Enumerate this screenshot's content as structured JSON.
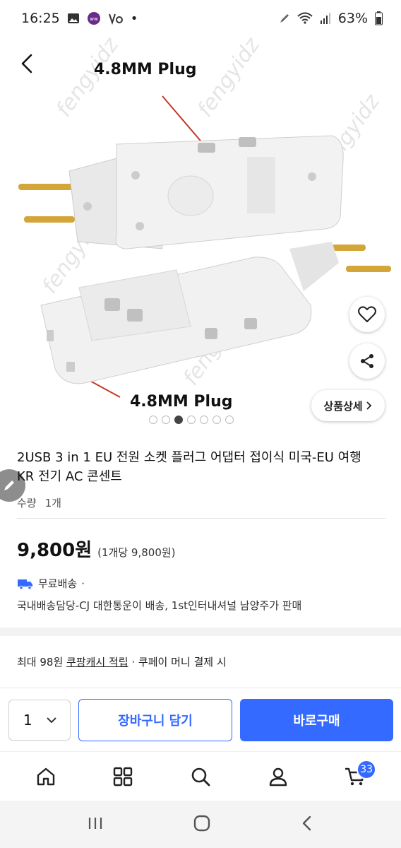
{
  "status": {
    "time": "16:25",
    "battery": "63%"
  },
  "hero": {
    "label_top": "4.8MM Plug",
    "label_bottom": "4.8MM Plug",
    "watermark": "fengyidz",
    "detail_button": "상품상세",
    "image_count": 7,
    "active_index": 2
  },
  "product": {
    "title": "2USB 3 in 1 EU 전원 소켓 플러그 어댑터 접이식 미국-EU 여행 KR 전기 AC 콘센트",
    "qty_label": "수량",
    "qty_value": "1개",
    "price": "9,800원",
    "unit_price": "(1개당 9,800원)",
    "shipping": "무료배송",
    "shipping_sep": "·",
    "shipping_note": "국내배송담당-CJ 대한통운이 배송, 1st인터내셔널 남양주가 판매",
    "cash_prefix": "최대 98원 ",
    "cash_link": "쿠팡캐시 적립",
    "cash_suffix": " · 쿠페이 머니 결제 시"
  },
  "buybar": {
    "qty": "1",
    "cart_label": "장바구니 담기",
    "buy_label": "바로구매"
  },
  "nav": {
    "cart_badge": "33"
  },
  "colors": {
    "accent": "#346aff"
  }
}
